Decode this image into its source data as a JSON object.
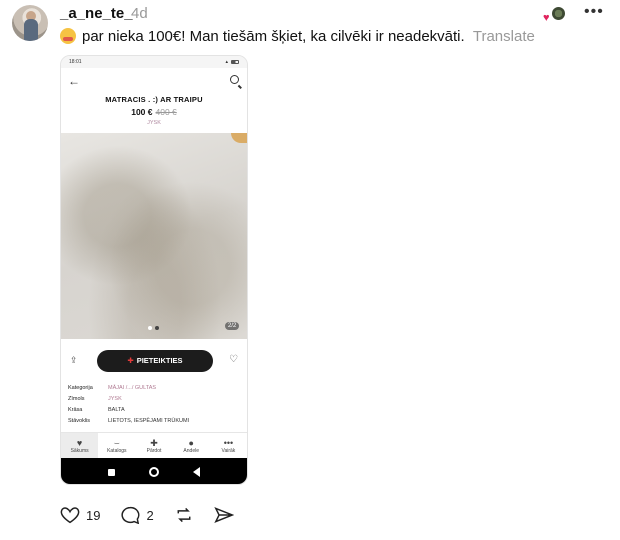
{
  "post": {
    "username": "_a_ne_te_",
    "time": "4d",
    "text": "par nieka 100€! Man tiešām šķiet, ka cilvēki ir neadekvāti.",
    "translate": "Translate",
    "likes": "19",
    "comments": "2"
  },
  "phone": {
    "status_time": "18:01",
    "title": "MATRACIS . :) AR TRAIPU",
    "price": "100 €",
    "old_price": "400 €",
    "brand": "JYSK",
    "photo_counter": "2/2",
    "cta": "PIETEIKTIES",
    "details": [
      {
        "label": "Kategorija",
        "value": "MĀJAI /.../ GULTAS"
      },
      {
        "label": "Zīmols",
        "value": "JYSK"
      },
      {
        "label": "Krāsa",
        "value": "BALTA"
      },
      {
        "label": "Stāvoklis",
        "value": "LIETOTS, IESPĒJAMI TRŪKUMI"
      }
    ],
    "tabs": [
      {
        "label": "Sākums",
        "icon": "heart-icon"
      },
      {
        "label": "Katalogs",
        "icon": "catalog-icon"
      },
      {
        "label": "Pārdot",
        "icon": "sell-icon"
      },
      {
        "label": "Andele",
        "icon": "chat-icon"
      },
      {
        "label": "Vairāk",
        "icon": "more-icon"
      }
    ]
  },
  "colors": {
    "accent": "#e0245e",
    "cta_bg": "#1c1c1c"
  }
}
